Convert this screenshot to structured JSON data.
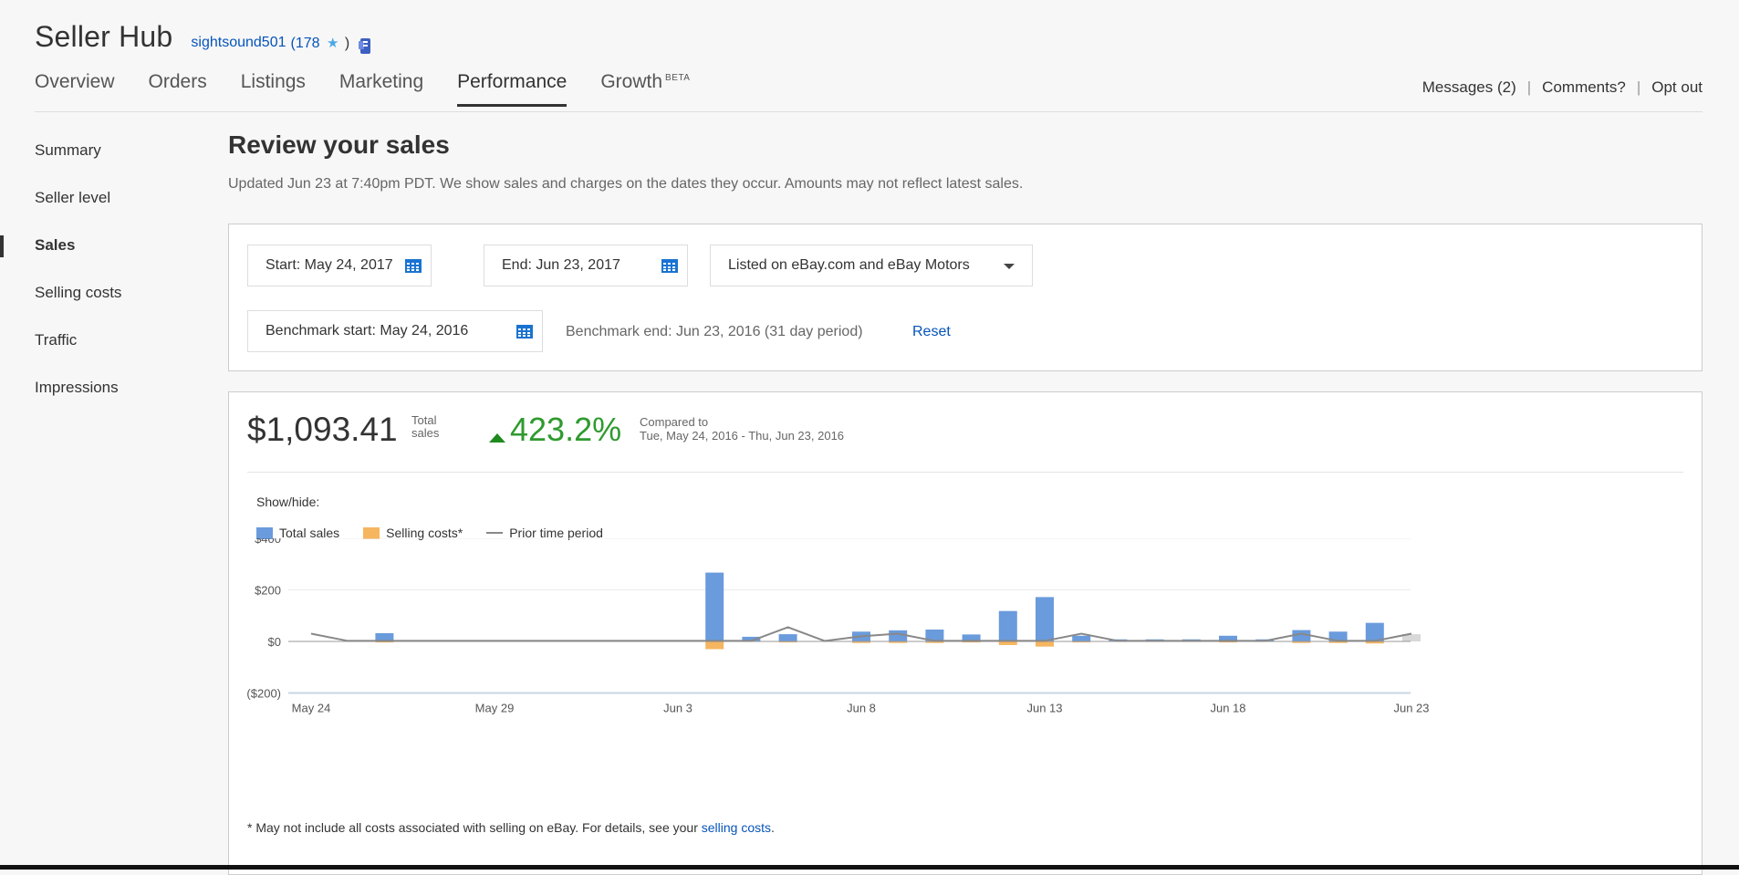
{
  "header": {
    "title": "Seller Hub",
    "username": "sightsound501",
    "feedback_open": "(178",
    "feedback_star": "★",
    "feedback_close": ")"
  },
  "tabs": [
    {
      "label": "Overview"
    },
    {
      "label": "Orders"
    },
    {
      "label": "Listings"
    },
    {
      "label": "Marketing"
    },
    {
      "label": "Performance",
      "active": true
    },
    {
      "label": "Growth",
      "sup": "BETA"
    }
  ],
  "toplinks": {
    "messages": "Messages (2)",
    "comments": "Comments?",
    "optout": "Opt out",
    "separator": "|"
  },
  "sidebar": {
    "items": [
      {
        "label": "Summary"
      },
      {
        "label": "Seller level"
      },
      {
        "label": "Sales",
        "active": true
      },
      {
        "label": "Selling costs"
      },
      {
        "label": "Traffic"
      },
      {
        "label": "Impressions"
      }
    ]
  },
  "main": {
    "title": "Review your sales",
    "subtitle": "Updated Jun 23 at 7:40pm PDT. We show sales and charges on the dates they occur. Amounts may not reflect latest sales."
  },
  "filters": {
    "start": "Start: May 24, 2017",
    "end": "End: Jun 23, 2017",
    "site": "Listed on eBay.com and eBay Motors",
    "benchmark_start": "Benchmark start: May 24, 2016",
    "benchmark_end": "Benchmark end: Jun 23, 2016 (31 day period)",
    "reset": "Reset"
  },
  "summary": {
    "total_value": "$1,093.41",
    "total_label": "Total sales",
    "pct_change": "423.2%",
    "compare_label": "Compared to",
    "compare_range": "Tue, May 24, 2016 - Thu, Jun 23, 2016"
  },
  "legend": {
    "showhide": "Show/hide:",
    "total_sales": "Total sales",
    "selling_costs": "Selling costs*",
    "prior": "Prior time period"
  },
  "footnote": {
    "text": "* May not include all costs associated with selling on eBay. For details, see your ",
    "link": "selling costs",
    "end": "."
  },
  "colors": {
    "total_sales": "#6a9bdc",
    "selling_costs": "#f6b55f",
    "prior": "#888888",
    "pending": "#d8d8d8",
    "link": "#0654ba",
    "positive": "#2f9a2f"
  },
  "chart_data": {
    "type": "bar",
    "y_ticks": [
      "$400",
      "$200",
      "$0",
      "($200)"
    ],
    "y_tick_values": [
      400,
      200,
      0,
      -200
    ],
    "ylim": [
      -200,
      400
    ],
    "x_tick_labels": [
      "May 24",
      "May 29",
      "Jun 3",
      "Jun 8",
      "Jun 13",
      "Jun 18",
      "Jun 23"
    ],
    "x_tick_index": [
      0,
      5,
      10,
      15,
      20,
      25,
      30
    ],
    "categories": [
      "May 24",
      "May 25",
      "May 26",
      "May 27",
      "May 28",
      "May 29",
      "May 30",
      "May 31",
      "Jun 1",
      "Jun 2",
      "Jun 3",
      "Jun 4",
      "Jun 5",
      "Jun 6",
      "Jun 7",
      "Jun 8",
      "Jun 9",
      "Jun 10",
      "Jun 11",
      "Jun 12",
      "Jun 13",
      "Jun 14",
      "Jun 15",
      "Jun 16",
      "Jun 17",
      "Jun 18",
      "Jun 19",
      "Jun 20",
      "Jun 21",
      "Jun 22",
      "Jun 23"
    ],
    "series": [
      {
        "name": "Total sales",
        "values": [
          0,
          0,
          32,
          0,
          0,
          0,
          0,
          0,
          0,
          0,
          0,
          267,
          18,
          28,
          0,
          38,
          43,
          46,
          27,
          118,
          172,
          22,
          8,
          8,
          8,
          22,
          8,
          44,
          38,
          72,
          0
        ]
      },
      {
        "name": "Selling costs*",
        "values": [
          0,
          0,
          -4,
          0,
          0,
          0,
          0,
          0,
          0,
          0,
          0,
          -30,
          -2,
          -4,
          0,
          -6,
          -6,
          -6,
          -4,
          -14,
          -20,
          -4,
          -2,
          -2,
          -2,
          -4,
          -2,
          -6,
          -6,
          -8,
          0
        ]
      },
      {
        "name": "Prior time period",
        "values": [
          30,
          2,
          2,
          2,
          2,
          2,
          2,
          2,
          2,
          2,
          2,
          2,
          2,
          55,
          2,
          20,
          30,
          2,
          2,
          2,
          2,
          30,
          2,
          2,
          2,
          2,
          2,
          30,
          2,
          2,
          30
        ]
      }
    ],
    "pending": {
      "index": 30,
      "value": 28
    }
  }
}
